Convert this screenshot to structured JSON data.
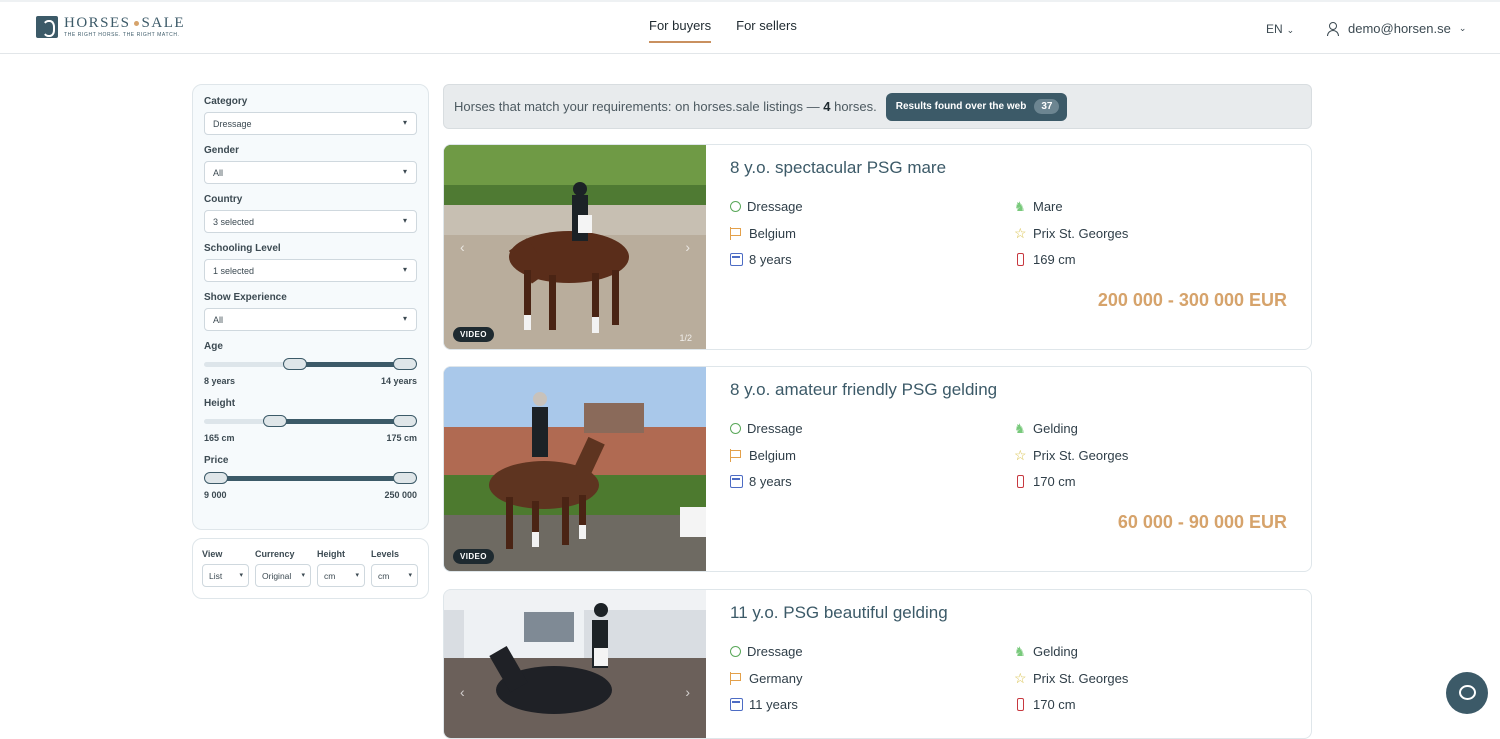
{
  "brand": {
    "name_left": "HORSES",
    "name_right": "SALE",
    "tagline": "THE RIGHT HORSE. THE RIGHT MATCH."
  },
  "nav": {
    "buyers": "For buyers",
    "sellers": "For sellers"
  },
  "header": {
    "lang": "EN",
    "user": "demo@horsen.se"
  },
  "filters": {
    "category": {
      "label": "Category",
      "value": "Dressage"
    },
    "gender": {
      "label": "Gender",
      "value": "All"
    },
    "country": {
      "label": "Country",
      "value": "3 selected"
    },
    "schooling": {
      "label": "Schooling Level",
      "value": "1 selected"
    },
    "show": {
      "label": "Show Experience",
      "value": "All"
    },
    "age": {
      "label": "Age",
      "min": "8 years",
      "max": "14 years",
      "range_low_fraction": 0.42,
      "range_high_fraction": 1.0
    },
    "height": {
      "label": "Height",
      "min": "165 cm",
      "max": "175 cm",
      "range_low_fraction": 0.31,
      "range_high_fraction": 1.0
    },
    "price": {
      "label": "Price",
      "min": "9 000",
      "max": "250 000",
      "range_low_fraction": 0.0,
      "range_high_fraction": 1.0
    }
  },
  "view_options": {
    "view": {
      "label": "View",
      "value": "List"
    },
    "currency": {
      "label": "Currency",
      "value": "Original"
    },
    "height": {
      "label": "Height",
      "value": "cm"
    },
    "levels": {
      "label": "Levels",
      "value": "cm"
    }
  },
  "results": {
    "text": "Horses that match your requirements: on horses.sale listings —",
    "count": "4",
    "suffix": "horses.",
    "web_button": "Results found over the web",
    "web_count": "37"
  },
  "listings": [
    {
      "title": "8 y.o. spectacular PSG mare",
      "discipline": "Dressage",
      "country": "Belgium",
      "age": "8 years",
      "gender": "Mare",
      "level": "Prix St. Georges",
      "height": "169 cm",
      "price": "200 000 - 300 000 EUR",
      "badge": "VIDEO",
      "counter": "1/2"
    },
    {
      "title": "8 y.o. amateur friendly PSG gelding",
      "discipline": "Dressage",
      "country": "Belgium",
      "age": "8 years",
      "gender": "Gelding",
      "level": "Prix St. Georges",
      "height": "170 cm",
      "price": "60 000 - 90 000 EUR",
      "badge": "VIDEO",
      "counter": ""
    },
    {
      "title": "11 y.o. PSG beautiful gelding",
      "discipline": "Dressage",
      "country": "Germany",
      "age": "11 years",
      "gender": "Gelding",
      "level": "Prix St. Georges",
      "height": "170 cm",
      "price": "",
      "badge": "",
      "counter": ""
    }
  ],
  "colors": {
    "brand": "#3c5a68",
    "accent": "#d6a36b",
    "price": "#d6a36b"
  }
}
